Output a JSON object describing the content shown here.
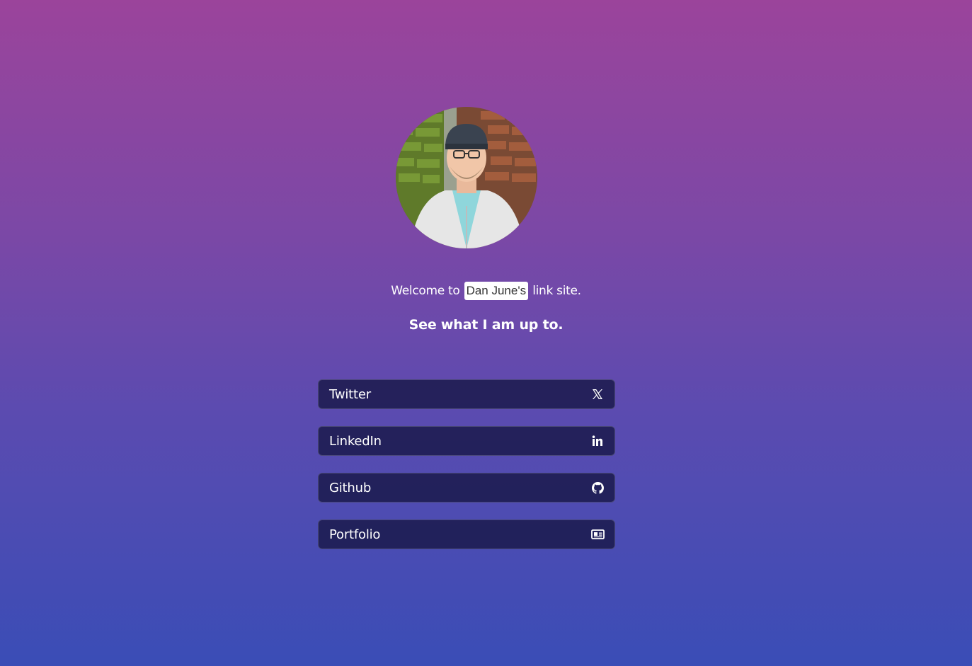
{
  "welcome": {
    "prefix": "Welcome to",
    "name": "Dan June's",
    "suffix": "link site."
  },
  "tagline": "See what I am up to.",
  "links": [
    {
      "label": "Twitter",
      "icon": "x-twitter-icon"
    },
    {
      "label": "LinkedIn",
      "icon": "linkedin-icon"
    },
    {
      "label": "Github",
      "icon": "github-icon"
    },
    {
      "label": "Portfolio",
      "icon": "id-card-icon"
    }
  ],
  "colors": {
    "gradient_top": "#9b449b",
    "gradient_bottom": "#3a4db6",
    "button_bg": "#1f1f4d",
    "text": "#ffffff"
  }
}
